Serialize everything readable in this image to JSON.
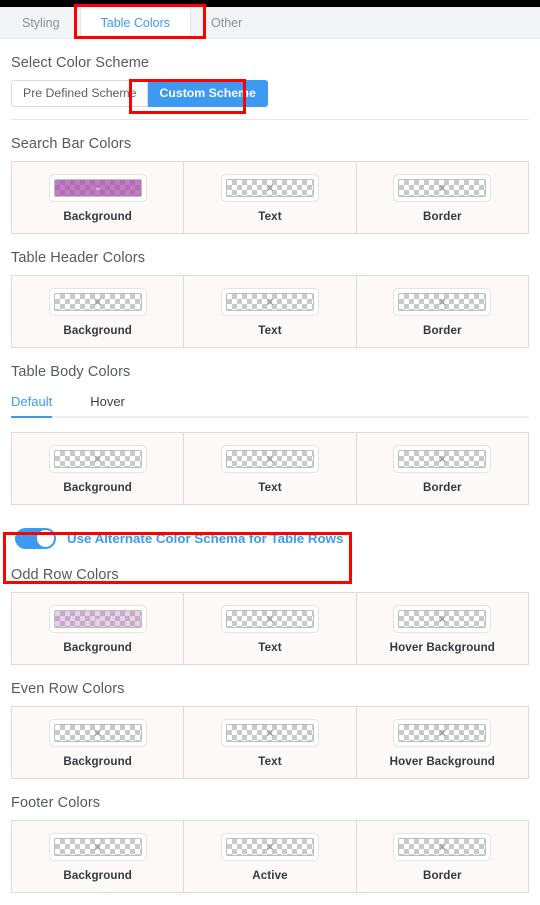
{
  "window": {
    "top_strip_color": "#000000"
  },
  "tabs": [
    {
      "label": "Styling",
      "active": false
    },
    {
      "label": "Table Colors",
      "active": true
    },
    {
      "label": "Other",
      "active": false
    }
  ],
  "scheme": {
    "title": "Select Color Scheme",
    "buttons": [
      {
        "label": "Pre Defined Scheme",
        "active": false
      },
      {
        "label": "Custom Scheme",
        "active": true
      }
    ],
    "active_color": "#3c9bf0"
  },
  "sections": [
    {
      "title": "Search Bar Colors",
      "cells": [
        {
          "label": "Background",
          "value": "tinted",
          "tint": "rgba(168,75,170,0.72)",
          "glyph": "chevron-down"
        },
        {
          "label": "Text",
          "value": "transparent",
          "tint": "",
          "glyph": "x"
        },
        {
          "label": "Border",
          "value": "transparent",
          "tint": "",
          "glyph": "x"
        }
      ]
    },
    {
      "title": "Table Header Colors",
      "cells": [
        {
          "label": "Background",
          "value": "transparent",
          "tint": "",
          "glyph": "x"
        },
        {
          "label": "Text",
          "value": "transparent",
          "tint": "",
          "glyph": "x"
        },
        {
          "label": "Border",
          "value": "transparent",
          "tint": "",
          "glyph": "x"
        }
      ]
    }
  ],
  "body_section": {
    "title": "Table Body Colors",
    "subtabs": [
      {
        "label": "Default",
        "active": true
      },
      {
        "label": "Hover",
        "active": false
      }
    ],
    "cells": [
      {
        "label": "Background",
        "value": "transparent",
        "tint": "",
        "glyph": "x"
      },
      {
        "label": "Text",
        "value": "transparent",
        "tint": "",
        "glyph": "x"
      },
      {
        "label": "Border",
        "value": "transparent",
        "tint": "",
        "glyph": "x"
      }
    ]
  },
  "alternate_toggle": {
    "label": "Use Alternate Color Schema for Table Rows",
    "state": "on",
    "color": "#3c9bf0"
  },
  "row_sections": [
    {
      "title": "Odd Row Colors",
      "cells": [
        {
          "label": "Background",
          "value": "tinted",
          "tint": "rgba(186,120,188,0.34)",
          "glyph": "chevron-down"
        },
        {
          "label": "Text",
          "value": "transparent",
          "tint": "",
          "glyph": "x"
        },
        {
          "label": "Hover Background",
          "value": "transparent",
          "tint": "",
          "glyph": "x"
        }
      ]
    },
    {
      "title": "Even Row Colors",
      "cells": [
        {
          "label": "Background",
          "value": "transparent",
          "tint": "",
          "glyph": "x"
        },
        {
          "label": "Text",
          "value": "transparent",
          "tint": "",
          "glyph": "x"
        },
        {
          "label": "Hover Background",
          "value": "transparent",
          "tint": "",
          "glyph": "x"
        }
      ]
    },
    {
      "title": "Footer Colors",
      "cells": [
        {
          "label": "Background",
          "value": "transparent",
          "tint": "",
          "glyph": "x"
        },
        {
          "label": "Active",
          "value": "transparent",
          "tint": "",
          "glyph": "x"
        },
        {
          "label": "Border",
          "value": "transparent",
          "tint": "",
          "glyph": "x"
        }
      ]
    }
  ],
  "annotations": [
    {
      "name": "table-colors-tab-highlight",
      "color": "#fe0000"
    },
    {
      "name": "custom-scheme-highlight",
      "color": "#fe0000"
    },
    {
      "name": "alternate-toggle-highlight",
      "color": "#fe0000"
    }
  ]
}
